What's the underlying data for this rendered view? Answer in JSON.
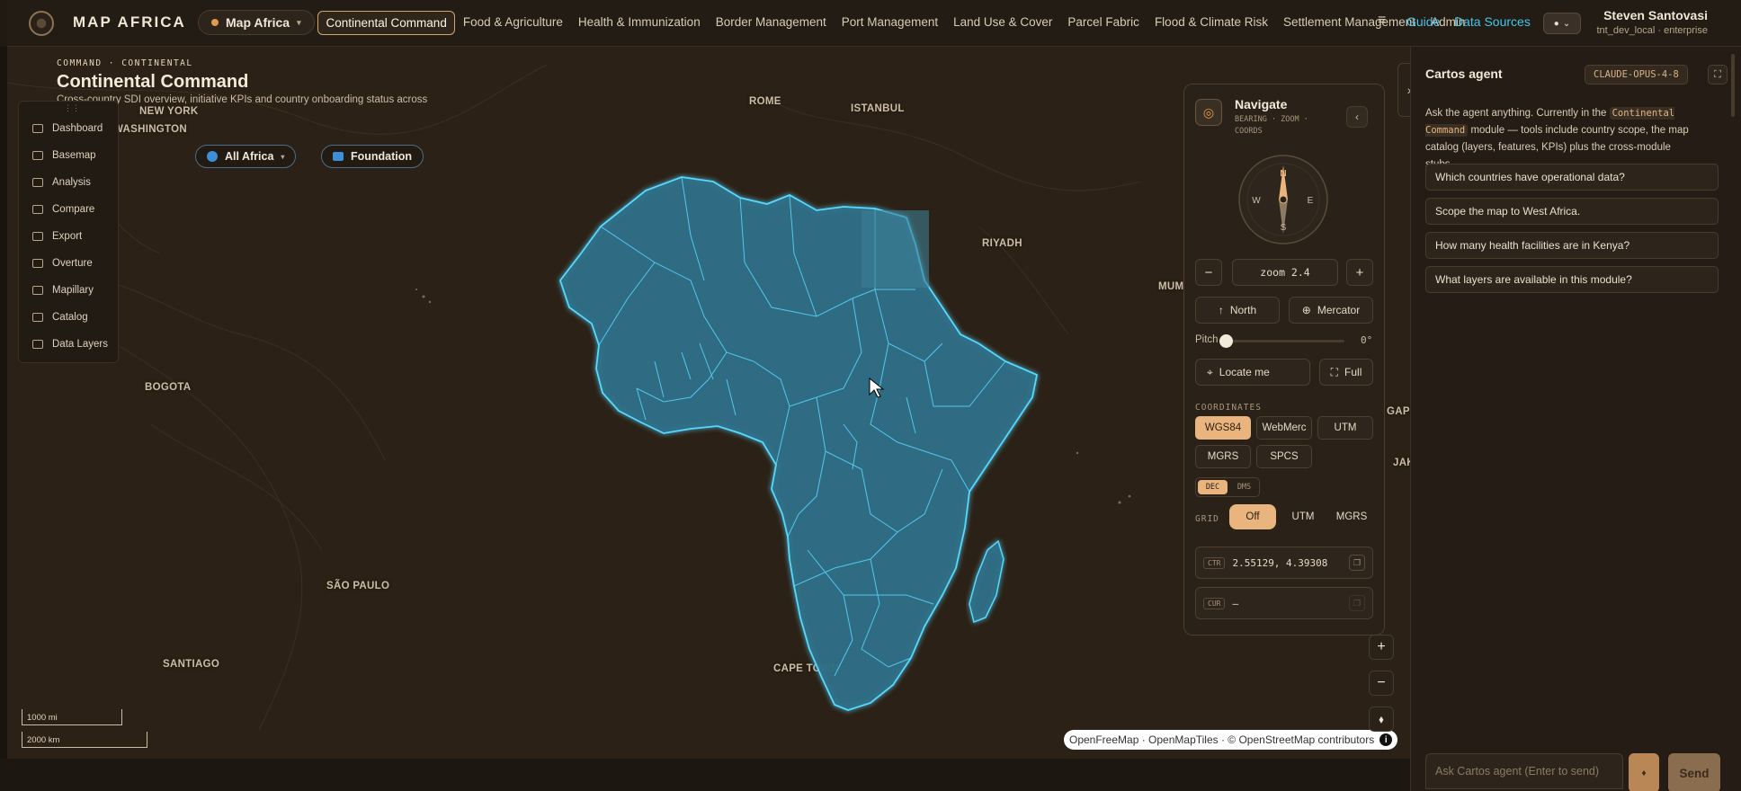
{
  "app": {
    "logo_text": "MAP AFRICA",
    "module_pill": "Map Africa"
  },
  "nav": {
    "items": [
      {
        "label": "Continental Command",
        "active": true
      },
      {
        "label": "Food & Agriculture"
      },
      {
        "label": "Health & Immunization"
      },
      {
        "label": "Border Management"
      },
      {
        "label": "Port Management"
      },
      {
        "label": "Land Use & Cover"
      },
      {
        "label": "Parcel Fabric"
      },
      {
        "label": "Flood & Climate Risk"
      },
      {
        "label": "Settlement Management"
      },
      {
        "label": "Admin"
      }
    ],
    "guide": "Guide",
    "data_sources": "Data Sources"
  },
  "user": {
    "name": "Steven Santovasi",
    "sub": "tnt_dev_local · enterprise"
  },
  "page": {
    "eyebrow": "COMMAND · CONTINENTAL",
    "title": "Continental Command",
    "subtitle": "Cross-country SDI overview, initiative KPIs and country onboarding status across"
  },
  "tool_rail": {
    "items": [
      "Dashboard",
      "Basemap",
      "Analysis",
      "Compare",
      "Export",
      "Overture",
      "Mapillary",
      "Catalog",
      "Data Layers"
    ]
  },
  "scope": {
    "region": "All Africa",
    "layer_set": "Foundation"
  },
  "map_labels": {
    "cities": [
      "NEW YORK",
      "WASHINGTON",
      "ROME",
      "ISTANBUL",
      "RIYADH",
      "BOGOTA",
      "SÃO PAULO",
      "SANTIAGO",
      "CAPE TOWN",
      "MUM",
      "JAK",
      "GAPO"
    ]
  },
  "scale": {
    "imperial": "1000 mi",
    "metric": "2000 km"
  },
  "attribution": {
    "text": "OpenFreeMap · OpenMapTiles · © OpenStreetMap contributors",
    "info": "i"
  },
  "navigate": {
    "title": "Navigate",
    "subtitle": "BEARING · ZOOM · COORDS",
    "compass": {
      "n": "N",
      "s": "S",
      "e": "E",
      "w": "W"
    },
    "zoom_label": "zoom 2.4",
    "north": "North",
    "projection": "Mercator",
    "pitch_label": "Pitch",
    "pitch_value": "0°",
    "locate": "Locate me",
    "full": "Full",
    "coordinates_label": "COORDINATES",
    "coord_systems": [
      {
        "label": "WGS84",
        "active": true
      },
      {
        "label": "WebMerc"
      },
      {
        "label": "UTM"
      },
      {
        "label": "MGRS"
      },
      {
        "label": "SPCS"
      }
    ],
    "format": {
      "dec": "DEC",
      "dms": "DMS",
      "active": "DEC"
    },
    "grid_label": "GRID",
    "grid_options": [
      {
        "label": "Off",
        "active": true
      },
      {
        "label": "UTM"
      },
      {
        "label": "MGRS"
      }
    ],
    "center": {
      "tag": "CTR",
      "value": "2.55129, 4.39308"
    },
    "cursor": {
      "tag": "CUR",
      "value": "–"
    }
  },
  "agent": {
    "title": "Cartos agent",
    "model": "CLAUDE-OPUS-4-8",
    "intro_before": "Ask the agent anything. Currently in the ",
    "intro_module": "Continental Command",
    "intro_after": " module — tools include country scope, the map catalog (layers, features, KPIs) plus the cross-module stubs.",
    "suggestions": [
      "Which countries have operational data?",
      "Scope the map to West Africa.",
      "How many health facilities are in Kenya?",
      "What layers are available in this module?"
    ],
    "input_placeholder": "Ask Cartos agent (Enter to send)",
    "send": "Send"
  },
  "colors": {
    "accent": "#e9b47e",
    "link": "#49c5e8",
    "map_land": "#2e6f86",
    "map_border": "#58d8ff"
  }
}
